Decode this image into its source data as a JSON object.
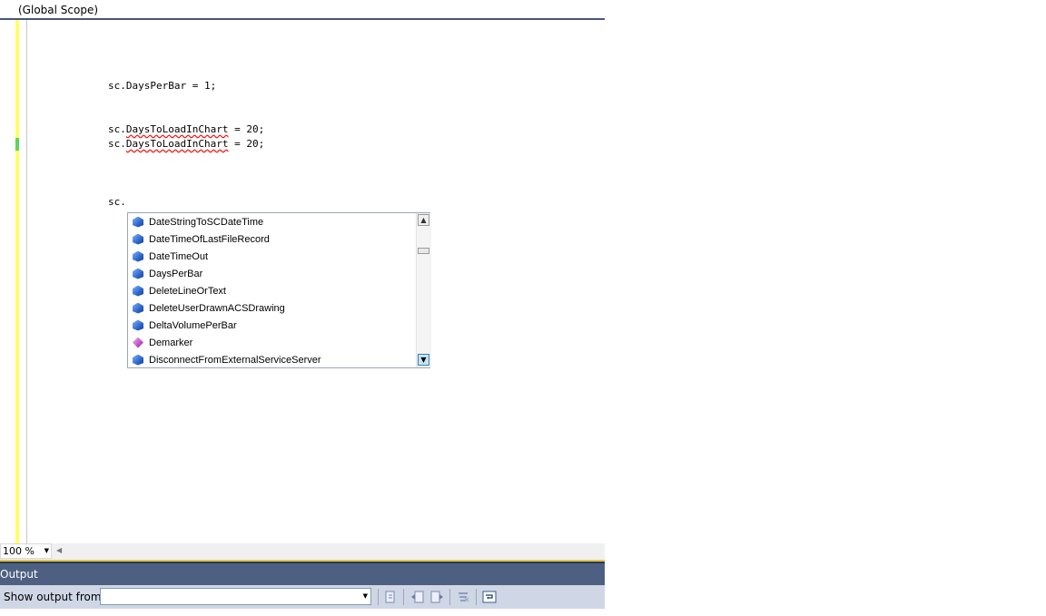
{
  "scope_bar": {
    "label": "(Global Scope)"
  },
  "code": {
    "lines": [
      "sc.DaysPerBar = 1;",
      "sc.DaysToLoadInChart = 20;",
      "sc.DaysToLoadInChart = 20;",
      "sc."
    ],
    "prefix": "sc.",
    "squiggle_word": "DaysToLoadInChart",
    "suffix": " = 20;"
  },
  "intellisense": {
    "items": [
      {
        "label": "DateStringToSCDateTime",
        "icon": "method-icon"
      },
      {
        "label": "DateTimeOfLastFileRecord",
        "icon": "method-icon"
      },
      {
        "label": "DateTimeOut",
        "icon": "method-icon"
      },
      {
        "label": "DaysPerBar",
        "icon": "method-icon"
      },
      {
        "label": "DeleteLineOrText",
        "icon": "method-icon"
      },
      {
        "label": "DeleteUserDrawnACSDrawing",
        "icon": "method-icon"
      },
      {
        "label": "DeltaVolumePerBar",
        "icon": "method-icon"
      },
      {
        "label": "Demarker",
        "icon": "event-icon"
      },
      {
        "label": "DisconnectFromExternalServiceServer",
        "icon": "method-icon"
      }
    ]
  },
  "zoom": {
    "value": "100 %"
  },
  "output": {
    "title": "Output",
    "show_label": "Show output from:",
    "show_value": ""
  },
  "colors": {
    "gutter_changed": "#ffff66",
    "gutter_saved": "#5fd35f",
    "output_title_bg": "#4d6082",
    "toolbar_bg": "#cfd6e5"
  }
}
